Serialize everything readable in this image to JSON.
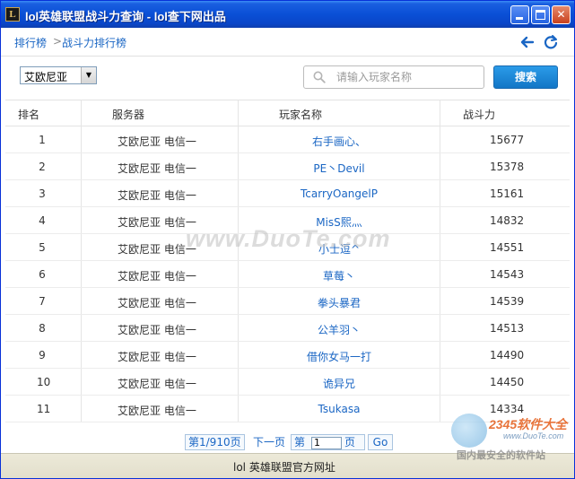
{
  "window": {
    "title": "lol英雄联盟战斗力查询 - lol查下网出品",
    "app_icon": "L"
  },
  "nav": {
    "breadcrumb_home": "排行榜",
    "breadcrumb_sep": ">",
    "breadcrumb_current": "战斗力排行榜"
  },
  "toolbar": {
    "server_selected": "艾欧尼亚",
    "search_placeholder": "请输入玩家名称",
    "search_button": "搜索"
  },
  "table": {
    "headers": [
      "排名",
      "服务器",
      "玩家名称",
      "战斗力"
    ],
    "rows": [
      {
        "rank": "1",
        "server": "艾欧尼亚 电信一",
        "player": "右手画心、",
        "power": "15677"
      },
      {
        "rank": "2",
        "server": "艾欧尼亚 电信一",
        "player": "PE丶Devil",
        "power": "15378"
      },
      {
        "rank": "3",
        "server": "艾欧尼亚 电信一",
        "player": "TcarryOangelP",
        "power": "15161"
      },
      {
        "rank": "4",
        "server": "艾欧尼亚 电信一",
        "player": "MisS熙灬",
        "power": "14832"
      },
      {
        "rank": "5",
        "server": "艾欧尼亚 电信一",
        "player": "小士逗^",
        "power": "14551"
      },
      {
        "rank": "6",
        "server": "艾欧尼亚 电信一",
        "player": "草莓丶",
        "power": "14543"
      },
      {
        "rank": "7",
        "server": "艾欧尼亚 电信一",
        "player": "拳头暴君",
        "power": "14539"
      },
      {
        "rank": "8",
        "server": "艾欧尼亚 电信一",
        "player": "公羊羽丶",
        "power": "14513"
      },
      {
        "rank": "9",
        "server": "艾欧尼亚 电信一",
        "player": "借你女马一打",
        "power": "14490"
      },
      {
        "rank": "10",
        "server": "艾欧尼亚 电信一",
        "player": "诡异兄",
        "power": "14450"
      },
      {
        "rank": "11",
        "server": "艾欧尼亚 电信一",
        "player": "Tsukasa",
        "power": "14334"
      }
    ]
  },
  "pager": {
    "page_info": "第1/910页",
    "next": "下一页",
    "goto_prefix": "第",
    "goto_value": "1",
    "goto_suffix": "页",
    "go": "Go"
  },
  "footer": {
    "text": "lol 英雄联盟官方网址"
  },
  "watermarks": {
    "duote": "www.DuoTe.com",
    "logo_2345": "2345软件大全",
    "logo_url": "www.DuoTe.com",
    "logo_slogan": "国内最安全的软件站"
  },
  "colors": {
    "link": "#1a66c4",
    "title_bar": "#0a4fd6",
    "search_button": "#1a80d0"
  }
}
